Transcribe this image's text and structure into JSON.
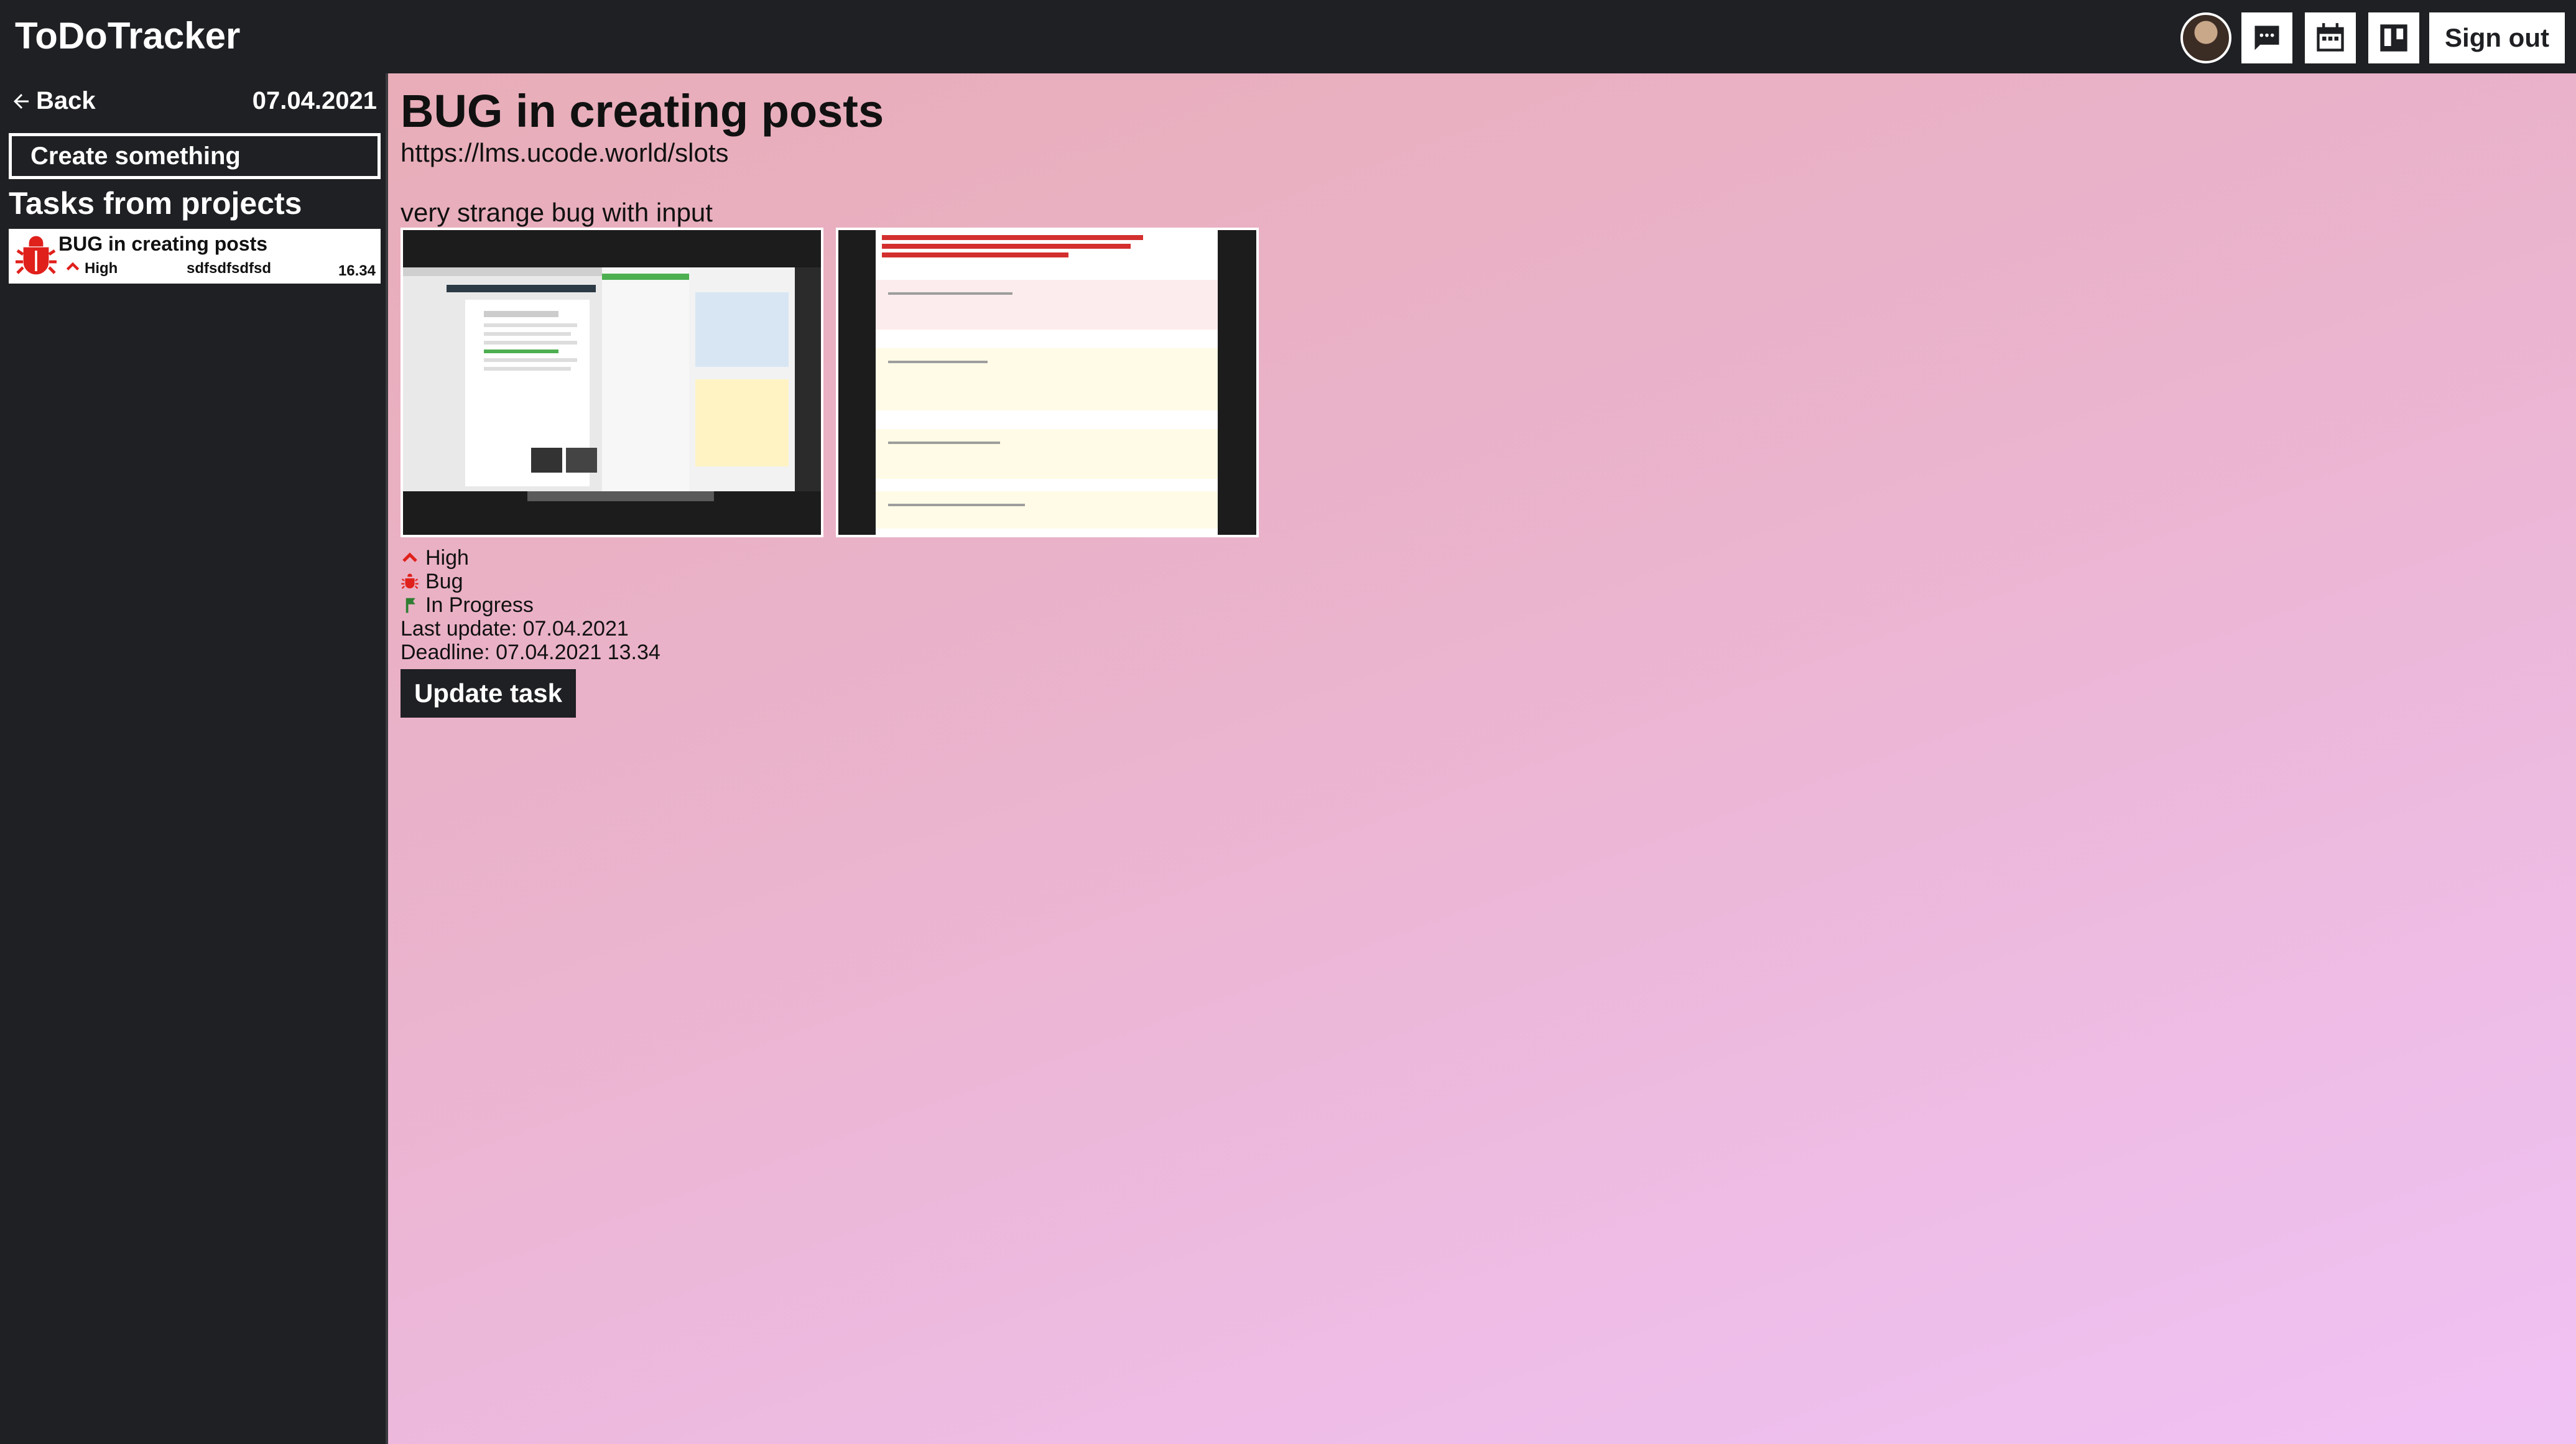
{
  "header": {
    "app_title": "ToDoTracker",
    "sign_out_label": "Sign out",
    "icons": [
      "avatar",
      "chat-icon",
      "calendar-icon",
      "board-icon"
    ]
  },
  "sidebar": {
    "back_label": "Back",
    "date": "07.04.2021",
    "create_label": "Create something",
    "section_title": "Tasks from projects",
    "tasks": [
      {
        "title": "BUG in creating posts",
        "priority": "High",
        "project": "sdfsdfsdfsd",
        "time": "16.34",
        "icon": "bug-icon"
      }
    ]
  },
  "main": {
    "title": "BUG in creating posts",
    "url": "https://lms.ucode.world/slots",
    "description": "very strange bug with input",
    "attachments": [
      "screenshot-browser",
      "screenshot-error"
    ],
    "priority": "High",
    "type": "Bug",
    "status": "In Progress",
    "last_update": "Last update: 07.04.2021",
    "deadline": "Deadline: 07.04.2021 13.34",
    "update_label": "Update task"
  },
  "colors": {
    "dark": "#1f2023",
    "priority_red": "#e0201b",
    "status_green": "#2f7d32"
  }
}
